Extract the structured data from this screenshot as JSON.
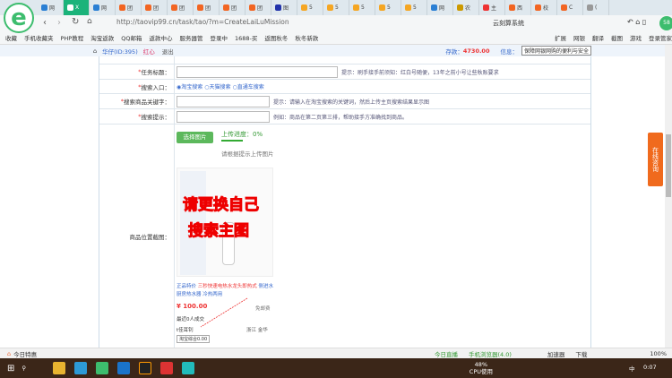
{
  "browser": {
    "tabs": [
      "网",
      "X",
      "网",
      "团",
      "团",
      "团",
      "团",
      "团",
      "团",
      "图",
      "5",
      "5",
      "5",
      "5",
      "5",
      "网",
      "农",
      "主",
      "西",
      "校",
      "C",
      "("
    ],
    "url": "http://taovip99.cn/task/tao/?m=CreateLaiLuMission",
    "search_engine_text": "云刻算系统",
    "bookmarks": [
      "收藏",
      "手机收藏夹",
      "PHP教程",
      "淘宝返款",
      "QQ邮箱",
      "返款中心",
      "服务器管",
      "登录中",
      "1688-买",
      "返图秋冬",
      "秋冬新款"
    ],
    "toolbar_right": [
      "扩展",
      "网银",
      "翻译",
      "截图",
      "游戏",
      "登录管家"
    ],
    "badge": "58"
  },
  "userbar": {
    "user": "华仔(ID:395)",
    "heart": "红心",
    "logout": "退出",
    "balance_label": "存款：",
    "balance": "4730.00",
    "info_label": "信息：",
    "tooltip": "保障网银网购的便利与安全"
  },
  "form": {
    "title_label": "任务标题：",
    "title_hint": "提示：刷手接手前须知：红白号随便，13年之前小号让些秋账要求",
    "entry_label": "搜索入口：",
    "entry_options": [
      "淘宝搜索",
      "天猫搜索",
      "直通车搜索"
    ],
    "keyword_label": "搜索商品关键字：",
    "keyword_hint": "提示：请输入在淘宝搜索的关键词，然后上传主页搜索结果显示图",
    "tip_label": "搜索提示：",
    "tip_hint": "例如：商品在第二页第三排，帮助接手方准确找到商品。",
    "upload_button": "选择图片",
    "upload_progress_label": "上传进度：0%",
    "upload_progress": 0,
    "upload_hint": "请根据提示上传图片",
    "screenshot_label": "商品位置截图：",
    "overlay": [
      "请更换自己",
      "搜索主图"
    ],
    "product_title_a": "正品特价 ",
    "product_title_b": "三秒快速电热水龙头即热式",
    "product_title_c": " 侧进水 厨房热水器 冷热两用",
    "price": "¥ 100.00",
    "shipping": "免邮费",
    "sold": "最近0人成交",
    "seller": "t佳耳钊",
    "location": "浙江 金华",
    "select": "淘宝综合0.00"
  },
  "side": {
    "consult": "在线咨询"
  },
  "statusbar": {
    "left": "今日特惠",
    "items": [
      "今日直播",
      "手机浏览器(4.0)",
      "加速器",
      "下载",
      "100%"
    ]
  },
  "taskbar": {
    "cpu": "48%",
    "cpu_label": "CPU使用",
    "ime": "中",
    "time": "0:07"
  }
}
